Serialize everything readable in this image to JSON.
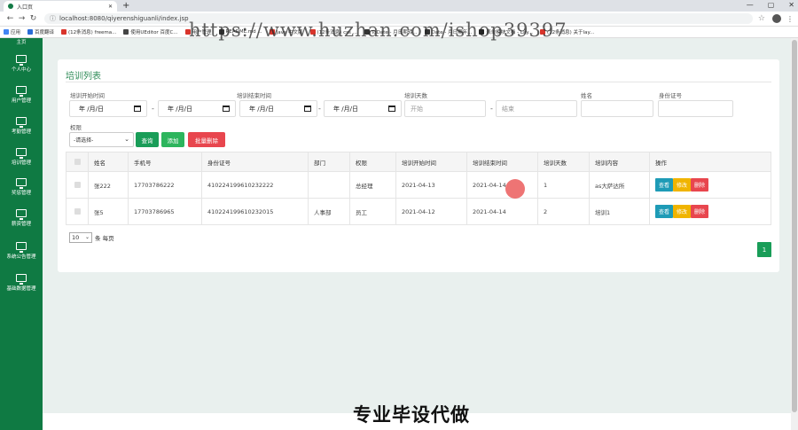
{
  "browser": {
    "tab_title": "入口页",
    "url": "localhost:8080/qiyerenshiguanli/index.jsp",
    "bookmarks": [
      "应用",
      "百度翻译",
      "(12条消息) freema...",
      "使用UEditor 百度C...",
      "用户管理",
      "README.md ...",
      "Java 中文版",
      "(12条消息) css ...",
      "ToDate - 月日期转...",
      "Date - 月日期年...",
      "表单模块文档 - Lay...",
      "(12条消息) 关于lay..."
    ]
  },
  "watermark": "https://www.huzhan.com/ishop39397",
  "sidebar": {
    "top_label": "主页",
    "items": [
      {
        "label": "个人中心"
      },
      {
        "label": "用户管理"
      },
      {
        "label": "考勤管理"
      },
      {
        "label": "培训管理"
      },
      {
        "label": "奖惩管理"
      },
      {
        "label": "薪资管理"
      },
      {
        "label": "系统公告管理"
      },
      {
        "label": "基础数据管理"
      }
    ]
  },
  "page": {
    "title": "培训列表",
    "filters": {
      "start_time_label": "培训开始时间",
      "end_time_label": "培训结束时间",
      "days_label": "培训天数",
      "name_label": "姓名",
      "id_label": "身份证号",
      "role_label": "权限",
      "date_placeholder": "年 /月/日",
      "days_from_placeholder": "开始",
      "days_to_placeholder": "结束",
      "dash": "-",
      "role_select": "-请选择-"
    },
    "buttons": {
      "search": "查询",
      "add": "添加",
      "batch_delete": "批量删除"
    },
    "table": {
      "headers": [
        "姓名",
        "手机号",
        "身份证号",
        "部门",
        "权限",
        "培训开始时间",
        "培训结束时间",
        "培训天数",
        "培训内容",
        "操作"
      ],
      "rows": [
        {
          "name": "张222",
          "phone": "17703786222",
          "id": "410224199610232222",
          "dept": "",
          "role": "总经理",
          "start": "2021-04-13",
          "end": "2021-04-14",
          "days": "1",
          "content": "as大萨达所"
        },
        {
          "name": "张5",
          "phone": "17703786965",
          "id": "410224199610232015",
          "dept": "人事部",
          "role": "员工",
          "start": "2021-04-12",
          "end": "2021-04-14",
          "days": "2",
          "content": "培训1"
        }
      ],
      "actions": {
        "view": "查看",
        "edit": "修改",
        "delete": "删除"
      }
    },
    "per_page": {
      "value": "10",
      "suffix": "条 每页"
    },
    "pagination": {
      "current": "1"
    }
  },
  "caption": "专业毕设代做",
  "colors": {
    "sidebar": "#0f7a43",
    "title": "#2e8b57",
    "search": "#199d58",
    "add": "#2db55d",
    "delete": "#e8464e",
    "view": "#1e9bb6",
    "edit": "#f0b400"
  }
}
